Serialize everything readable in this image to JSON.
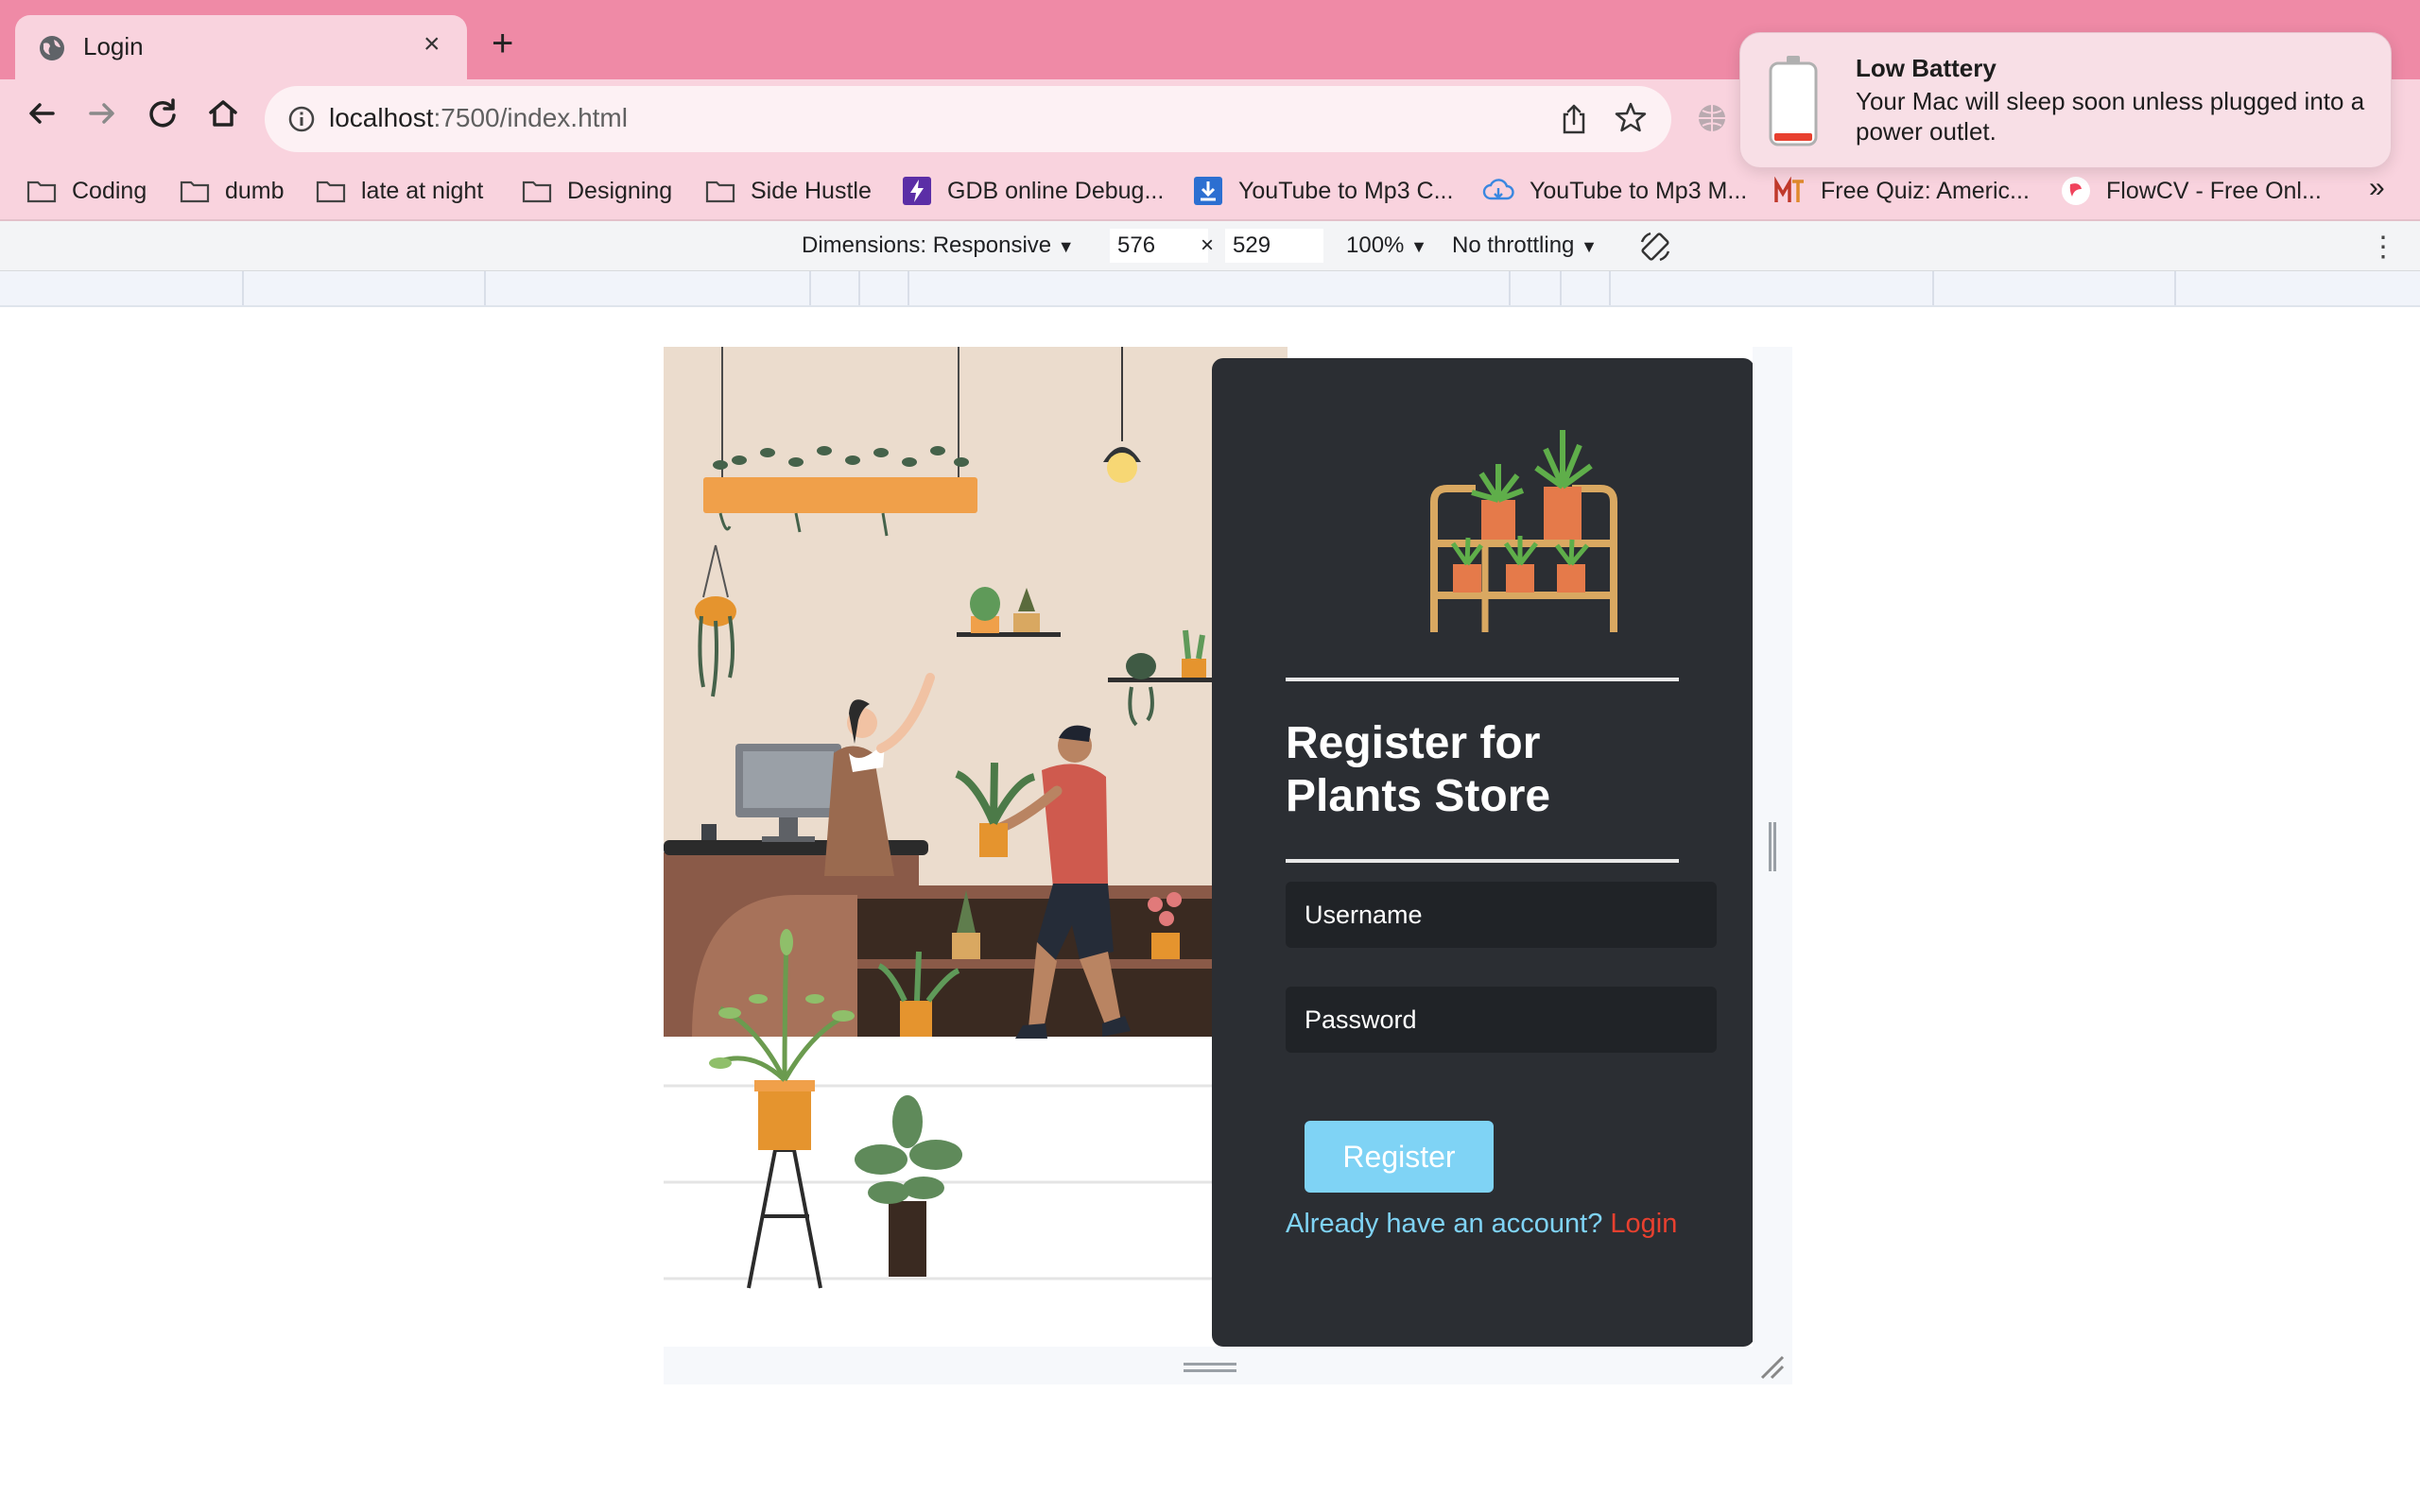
{
  "browser": {
    "tab_title": "Login",
    "url_host": "localhost",
    "url_path": ":7500/index.html",
    "bookmarks": [
      "Coding",
      "dumb",
      "late at night",
      "Designing",
      "Side Hustle",
      "GDB online Debug...",
      "YouTube to Mp3 C...",
      "YouTube to Mp3 M...",
      "Free Quiz: Americ...",
      "FlowCV - Free Onl..."
    ],
    "bookmarks_overflow": "»",
    "new_tab": "+",
    "close_tab": "×"
  },
  "devtools": {
    "dimensions_label": "Dimensions: Responsive",
    "width": "576",
    "times": "×",
    "height": "529",
    "zoom": "100%",
    "throttling": "No throttling",
    "dropdown_caret": "▼",
    "more": "⋮"
  },
  "page": {
    "title": "Register for Plants Store",
    "username_placeholder": "Username",
    "password_placeholder": "Password",
    "register_label": "Register",
    "account_prompt": "Already have an account?",
    "login_link": "Login"
  },
  "notification": {
    "title": "Low Battery",
    "body": "Your Mac will sleep soon unless plugged into a power outlet."
  },
  "colors": {
    "tabstrip": "#ef8aa6",
    "toolbar": "#f9d3de",
    "form_card": "#2b2e33",
    "register_button": "#7fd3f5",
    "login_link": "#e8402f"
  }
}
